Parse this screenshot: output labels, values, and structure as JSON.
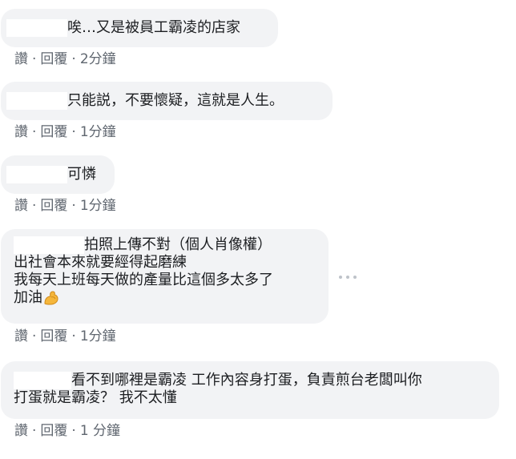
{
  "comments": [
    {
      "text_lines": [
        "唉…又是被員工霸凌的店家"
      ],
      "like_label": "讚",
      "reply_label": "回覆",
      "time": "2分鐘"
    },
    {
      "text_lines": [
        "只能説，不要懷疑，這就是人生。"
      ],
      "like_label": "讚",
      "reply_label": "回覆",
      "time": "1分鐘"
    },
    {
      "text_lines": [
        "可憐"
      ],
      "like_label": "讚",
      "reply_label": "回覆",
      "time": "1分鐘"
    },
    {
      "text_lines": [
        "拍照上傳不對（個人肖像權）",
        "出社會本來就要經得起磨練",
        "我每天上班每天做的產量比這個多太多了",
        "加油"
      ],
      "emoji": "flexed-biceps",
      "like_label": "讚",
      "reply_label": "回覆",
      "time": "1分鐘"
    },
    {
      "text_lines": [
        "看不到哪裡是霸凌 工作內容身打蛋，負責煎台老闆叫你",
        "打蛋就是霸凌？ 我不太懂"
      ],
      "like_label": "讚",
      "reply_label": "回覆",
      "time": "1 分鐘"
    }
  ],
  "separator": "·",
  "colors": {
    "bubble_bg": "#f2f3f5",
    "text": "#1c1e21",
    "meta_text": "#606770",
    "more_dots": "#bec3c9"
  },
  "icons": [
    "more-options-icon",
    "flexed-biceps-emoji"
  ]
}
